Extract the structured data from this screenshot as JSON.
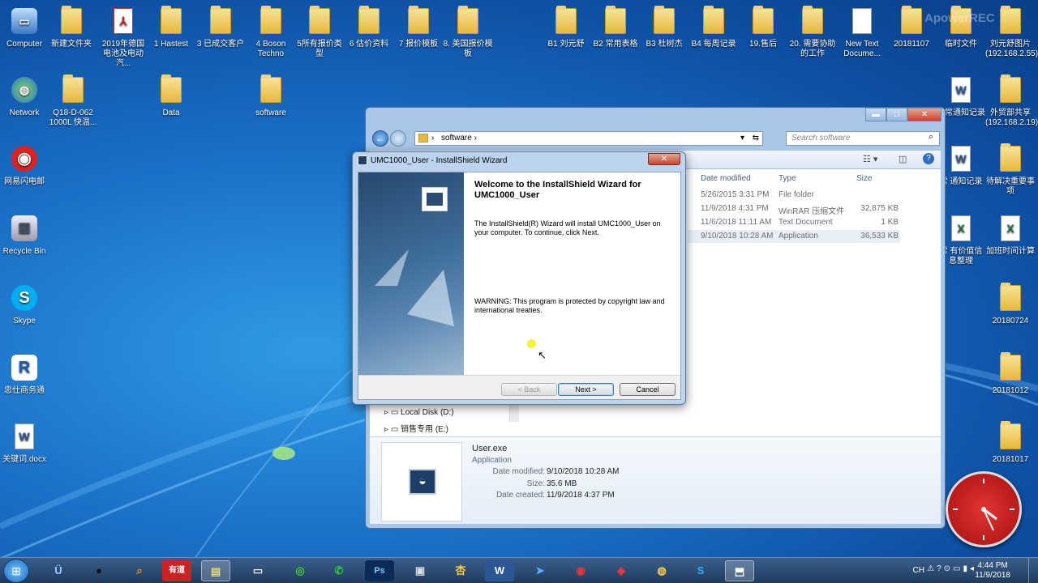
{
  "desktop": {
    "icons": [
      {
        "label": "Computer"
      },
      {
        "label": "新建文件夹"
      },
      {
        "label": "2019年德国电池及电动汽..."
      },
      {
        "label": "1 Hastest"
      },
      {
        "label": "3 已成交客户"
      },
      {
        "label": "4 Boson Techno"
      },
      {
        "label": "5所有报价类型"
      },
      {
        "label": "6 估价资料"
      },
      {
        "label": "7 报价模板"
      },
      {
        "label": "8. 美国报价模板"
      },
      {
        "label": "B1 刘元舒"
      },
      {
        "label": "B2 常用表格"
      },
      {
        "label": "B3 杜树杰"
      },
      {
        "label": "B4 每周记录"
      },
      {
        "label": "19.售后"
      },
      {
        "label": "20. 需要协助的工作"
      },
      {
        "label": "New Text Docume..."
      },
      {
        "label": "20181107"
      },
      {
        "label": "临时文件"
      },
      {
        "label": "刘元舒图片 (192.168.2.55)"
      },
      {
        "label": "Network"
      },
      {
        "label": "Q18-D-062 1000L 快温..."
      },
      {
        "label": "Data"
      },
      {
        "label": "software"
      },
      {
        "label": "日常通知记录"
      },
      {
        "label": "外贸部共享 (192.168.2.19)"
      },
      {
        "label": "网易闪电邮"
      },
      {
        "label": "常 通知记录"
      },
      {
        "label": "待解决重要事项"
      },
      {
        "label": "Recycle Bin"
      },
      {
        "label": "常 有价值信息整理"
      },
      {
        "label": "加班时间计算"
      },
      {
        "label": "Skype"
      },
      {
        "label": "20180724"
      },
      {
        "label": "忠仕商务通"
      },
      {
        "label": "20181012"
      },
      {
        "label": "关键词.docx"
      },
      {
        "label": "20181017"
      }
    ],
    "watermark": "ApowerREC"
  },
  "explorer": {
    "breadcrumb_folder": "software",
    "search_placeholder": "Search software",
    "columns": {
      "date": "Date modified",
      "type": "Type",
      "size": "Size"
    },
    "rows": [
      {
        "date": "5/26/2015 3:31 PM",
        "type": "File folder",
        "size": ""
      },
      {
        "date": "11/9/2018 4:31 PM",
        "type": "WinRAR 压缩文件",
        "size": "32,875 KB"
      },
      {
        "date": "11/6/2018 11:11 AM",
        "type": "Text Document",
        "size": "1 KB"
      },
      {
        "date": "9/10/2018 10:28 AM",
        "type": "Application",
        "size": "36,533 KB"
      }
    ],
    "tree": [
      {
        "label": "Local Disk (D:)"
      },
      {
        "label": "销售专用 (E:)"
      }
    ],
    "details": {
      "name": "User.exe",
      "kind": "Application",
      "date_modified_label": "Date modified:",
      "date_modified": "9/10/2018 10:28 AM",
      "size_label": "Size:",
      "size": "35.6 MB",
      "date_created_label": "Date created:",
      "date_created": "11/9/2018 4:37 PM"
    }
  },
  "wizard": {
    "title": "UMC1000_User - InstallShield Wizard",
    "heading": "Welcome to the InstallShield Wizard for UMC1000_User",
    "body": "The InstallShield(R) Wizard will install UMC1000_User on your computer. To continue, click Next.",
    "warning": "WARNING: This program is protected by copyright law and international treaties.",
    "back_label": "< Back",
    "next_label": "Next >",
    "cancel_label": "Cancel"
  },
  "taskbar": {
    "lang": "CH",
    "time": "4:44 PM",
    "date": "11/9/2018"
  }
}
